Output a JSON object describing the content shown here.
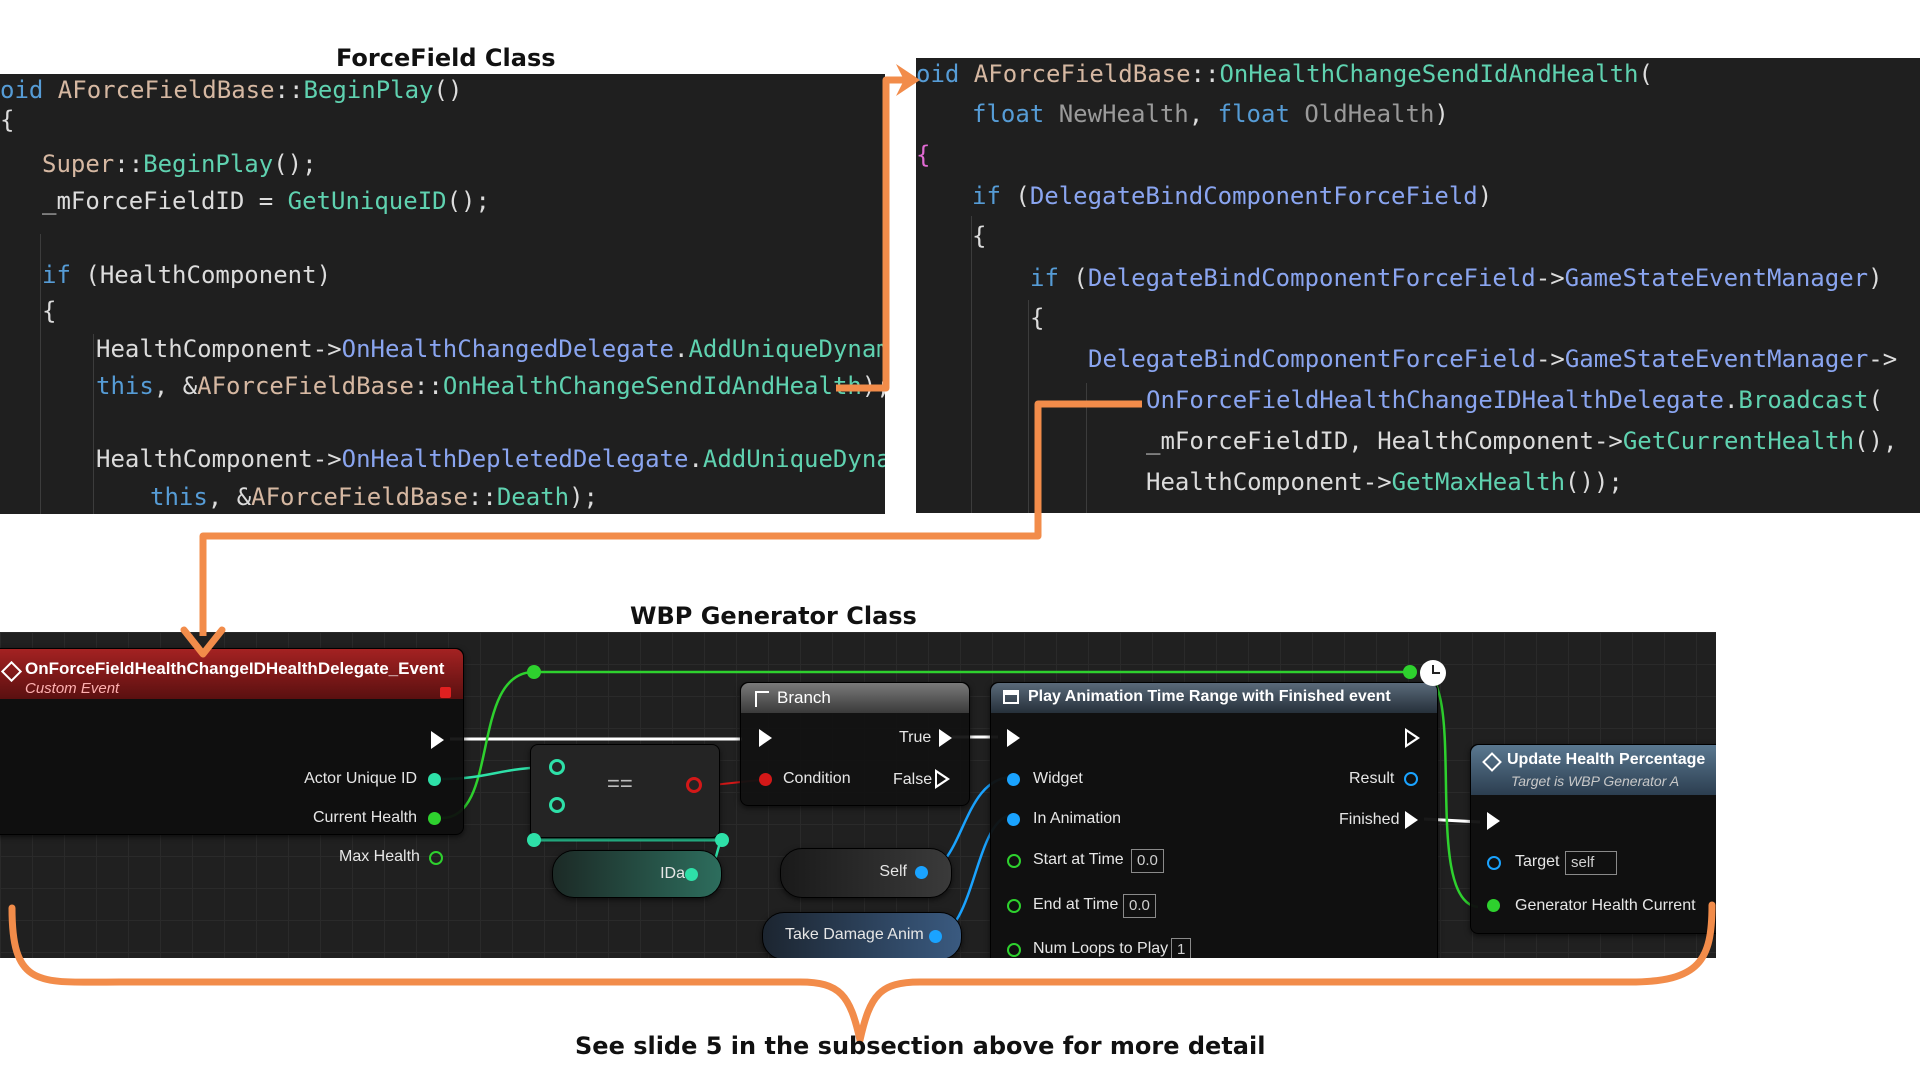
{
  "titles": {
    "forcefield": "ForceField Class",
    "wbp": "WBP Generator Class",
    "footer_note": "See slide 5 in the subsection above for more detail"
  },
  "code_left": [
    [
      [
        "k",
        "oid "
      ],
      [
        "t",
        "AForceFieldBase"
      ],
      [
        "p",
        "::"
      ],
      [
        "f",
        "BeginPlay"
      ],
      [
        "p",
        "()"
      ]
    ],
    [
      [
        "p",
        "{"
      ]
    ],
    [
      [
        "t",
        "Super"
      ],
      [
        "p",
        "::"
      ],
      [
        "f",
        "BeginPlay"
      ],
      [
        "p",
        "();"
      ]
    ],
    [
      [
        "v",
        "_mForceFieldID"
      ],
      [
        "p",
        " = "
      ],
      [
        "f",
        "GetUniqueID"
      ],
      [
        "p",
        "();"
      ]
    ],
    [],
    [
      [
        "k",
        "if"
      ],
      [
        "p",
        " ("
      ],
      [
        "v",
        "HealthComponent"
      ],
      [
        "p",
        ")"
      ]
    ],
    [
      [
        "p",
        "{"
      ]
    ],
    [
      [
        "v",
        "HealthComponent"
      ],
      [
        "p",
        "->"
      ],
      [
        "m",
        "OnHealthChangedDelegate"
      ],
      [
        "p",
        "."
      ],
      [
        "f",
        "AddUniqueDynamic"
      ],
      [
        "p",
        "("
      ]
    ],
    [
      [
        "k",
        "this"
      ],
      [
        "p",
        ", &"
      ],
      [
        "t",
        "AForceFieldBase"
      ],
      [
        "p",
        "::"
      ],
      [
        "f",
        "OnHealthChangeSendIdAndHealth"
      ],
      [
        "p",
        ");"
      ]
    ],
    [],
    [
      [
        "v",
        "HealthComponent"
      ],
      [
        "p",
        "->"
      ],
      [
        "m",
        "OnHealthDepletedDelegate"
      ],
      [
        "p",
        "."
      ],
      [
        "f",
        "AddUniqueDynamic"
      ],
      [
        "p",
        "("
      ]
    ],
    [
      [
        "k",
        "this"
      ],
      [
        "p",
        ", &"
      ],
      [
        "t",
        "AForceFieldBase"
      ],
      [
        "p",
        "::"
      ],
      [
        "f",
        "Death"
      ],
      [
        "p",
        ");"
      ]
    ]
  ],
  "code_right": [
    [
      [
        "k",
        "oid "
      ],
      [
        "t",
        "AForceFieldBase"
      ],
      [
        "p",
        "::"
      ],
      [
        "f",
        "OnHealthChangeSendIdAndHealth"
      ],
      [
        "p",
        "("
      ]
    ],
    [
      [
        "k",
        "float "
      ],
      [
        "param",
        "NewHealth"
      ],
      [
        "p",
        ", "
      ],
      [
        "k",
        "float "
      ],
      [
        "param",
        "OldHealth"
      ],
      [
        "p",
        ")"
      ]
    ],
    [
      [
        "b",
        "{"
      ]
    ],
    [
      [
        "k",
        "if"
      ],
      [
        "p",
        " ("
      ],
      [
        "m",
        "DelegateBindComponentForceField"
      ],
      [
        "p",
        ")"
      ]
    ],
    [
      [
        "p",
        "{"
      ]
    ],
    [
      [
        "k",
        "if"
      ],
      [
        "p",
        " ("
      ],
      [
        "m",
        "DelegateBindComponentForceField"
      ],
      [
        "p",
        "->"
      ],
      [
        "m",
        "GameStateEventManager"
      ],
      [
        "p",
        ")"
      ]
    ],
    [
      [
        "p",
        "{"
      ]
    ],
    [
      [
        "m",
        "DelegateBindComponentForceField"
      ],
      [
        "p",
        "->"
      ],
      [
        "m",
        "GameStateEventManager"
      ],
      [
        "p",
        "->"
      ]
    ],
    [
      [
        "m",
        "OnForceFieldHealthChangeIDHealthDelegate"
      ],
      [
        "p",
        "."
      ],
      [
        "f",
        "Broadcast"
      ],
      [
        "p",
        "("
      ]
    ],
    [
      [
        "v",
        "_mForceFieldID"
      ],
      [
        "p",
        ", "
      ],
      [
        "v",
        "HealthComponent"
      ],
      [
        "p",
        "->"
      ],
      [
        "f",
        "GetCurrentHealth"
      ],
      [
        "p",
        "(),"
      ]
    ],
    [
      [
        "v",
        "HealthComponent"
      ],
      [
        "p",
        "->"
      ],
      [
        "f",
        "GetMaxHealth"
      ],
      [
        "p",
        "());"
      ]
    ]
  ],
  "blueprint": {
    "event_node": {
      "title": "OnForceFieldHealthChangeIDHealthDelegate_Event",
      "subtitle": "Custom Event",
      "pins": [
        "Actor Unique ID",
        "Current Health",
        "Max Health"
      ]
    },
    "equals_node": {
      "symbol": "=="
    },
    "ida_node": {
      "label": "IDa"
    },
    "branch_node": {
      "title": "Branch",
      "condition": "Condition",
      "true_label": "True",
      "false_label": "False"
    },
    "self_node": {
      "label": "Self"
    },
    "anim_var_node": {
      "label": "Take Damage Anim"
    },
    "play_anim_node": {
      "title": "Play Animation Time Range with Finished event",
      "widget": "Widget",
      "in_animation": "In Animation",
      "start_at_time": "Start at Time",
      "start_at_time_value": "0.0",
      "end_at_time": "End at Time",
      "end_at_time_value": "0.0",
      "num_loops": "Num Loops to Play",
      "num_loops_value": "1",
      "result": "Result",
      "finished": "Finished"
    },
    "update_node": {
      "title": "Update Health Percentage",
      "subtitle": "Target is WBP Generator A",
      "target": "Target",
      "target_value": "self",
      "generator_health": "Generator Health Current"
    }
  },
  "colors": {
    "accent_orange": "#f28c4a",
    "event_header": "#8b1c1c",
    "exec_white": "#ffffff",
    "pin_green": "#2ed12e",
    "pin_teal": "#2ee0a8",
    "pin_blue": "#1aa3ff",
    "pin_red": "#d31818"
  }
}
